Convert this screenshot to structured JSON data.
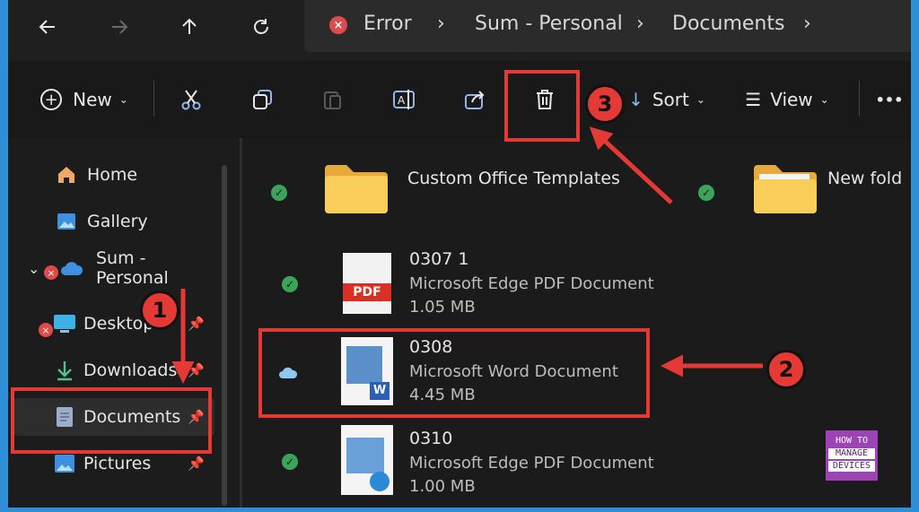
{
  "breadcrumb": {
    "error": "Error",
    "cloud": "Sum - Personal",
    "folder": "Documents"
  },
  "toolbar": {
    "new_label": "New",
    "sort_label": "Sort",
    "view_label": "View",
    "more_label": "•••"
  },
  "sidebar": {
    "items": [
      {
        "label": "Home"
      },
      {
        "label": "Gallery"
      },
      {
        "label": "Sum - Personal"
      },
      {
        "label": "Desktop"
      },
      {
        "label": "Downloads"
      },
      {
        "label": "Documents"
      },
      {
        "label": "Pictures"
      }
    ]
  },
  "folders": [
    {
      "name": "Custom Office Templates"
    },
    {
      "name": "New fold"
    }
  ],
  "files": [
    {
      "name": "0307 1",
      "type": "Microsoft Edge PDF Document",
      "size": "1.05 MB",
      "thumb": "PDF"
    },
    {
      "name": "0308",
      "type": "Microsoft Word Document",
      "size": "4.45 MB"
    },
    {
      "name": "0310",
      "type": "Microsoft Edge PDF Document",
      "size": "1.00 MB"
    }
  ],
  "annotations": {
    "step1": "1",
    "step2": "2",
    "step3": "3"
  },
  "watermark": {
    "line1": "HOW TO",
    "line2": "MANAGE",
    "line3": "DEVICES"
  },
  "colors": {
    "accent": "#e53935",
    "window_bg": "#1c1c1c",
    "frame": "#2f8fd6",
    "sync_green": "#3aa55a"
  },
  "icons": [
    "back-arrow-icon",
    "forward-arrow-icon",
    "up-arrow-icon",
    "refresh-icon",
    "error-icon",
    "chevron-right-icon",
    "add-icon",
    "cut-icon",
    "copy-icon",
    "paste-icon",
    "rename-icon",
    "share-icon",
    "delete-icon",
    "sort-icon",
    "view-icon",
    "more-icon",
    "home-icon",
    "gallery-icon",
    "cloud-icon",
    "desktop-icon",
    "download-icon",
    "documents-icon",
    "pictures-icon",
    "pin-icon",
    "folder-icon",
    "sync-check-icon"
  ]
}
